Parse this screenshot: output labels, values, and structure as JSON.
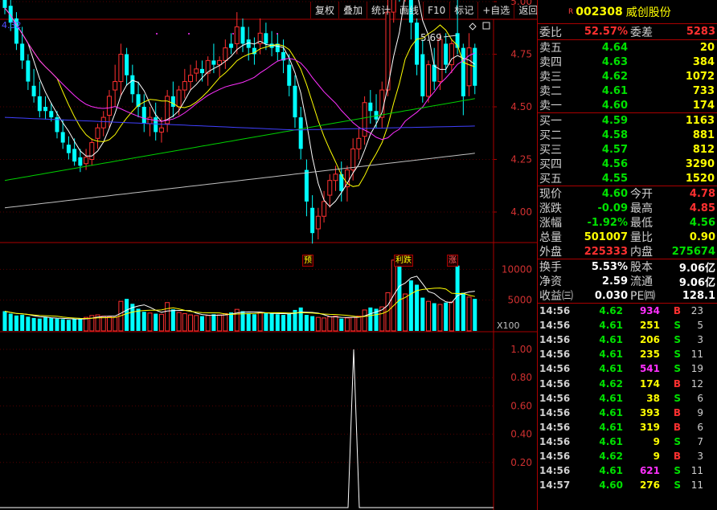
{
  "toolbar": [
    "复权",
    "叠加",
    "统计",
    "画线",
    "F10",
    "标记",
    "+自选",
    "返回"
  ],
  "price_corner": "4.32",
  "high_label": "5.69",
  "volume_unit": "X100",
  "tags": [
    "预",
    "利跌",
    "涨"
  ],
  "stock": {
    "badge": "R",
    "code": "002308",
    "name": "威创股份"
  },
  "order_ratio": {
    "label1": "委比",
    "value1": "52.57%",
    "label2": "委差",
    "value2": "5283"
  },
  "sell": [
    {
      "label": "卖五",
      "price": "4.64",
      "vol": "20"
    },
    {
      "label": "卖四",
      "price": "4.63",
      "vol": "384"
    },
    {
      "label": "卖三",
      "price": "4.62",
      "vol": "1072"
    },
    {
      "label": "卖二",
      "price": "4.61",
      "vol": "733"
    },
    {
      "label": "卖一",
      "price": "4.60",
      "vol": "174"
    }
  ],
  "buy": [
    {
      "label": "买一",
      "price": "4.59",
      "vol": "1163"
    },
    {
      "label": "买二",
      "price": "4.58",
      "vol": "881"
    },
    {
      "label": "买三",
      "price": "4.57",
      "vol": "812"
    },
    {
      "label": "买四",
      "price": "4.56",
      "vol": "3290"
    },
    {
      "label": "买五",
      "price": "4.55",
      "vol": "1520"
    }
  ],
  "quote": [
    {
      "l1": "现价",
      "v1": "4.60",
      "c1": "green",
      "l2": "今开",
      "v2": "4.78",
      "c2": "red"
    },
    {
      "l1": "涨跌",
      "v1": "-0.09",
      "c1": "green",
      "l2": "最高",
      "v2": "4.85",
      "c2": "red"
    },
    {
      "l1": "涨幅",
      "v1": "-1.92%",
      "c1": "green",
      "l2": "最低",
      "v2": "4.56",
      "c2": "green"
    },
    {
      "l1": "总量",
      "v1": "501007",
      "c1": "yellow",
      "l2": "量比",
      "v2": "0.90",
      "c2": "yellow"
    },
    {
      "l1": "外盘",
      "v1": "225333",
      "c1": "red",
      "l2": "内盘",
      "v2": "275674",
      "c2": "green"
    }
  ],
  "fund": [
    {
      "l1": "换手",
      "v1": "5.53%",
      "l2": "股本",
      "v2": "9.06亿"
    },
    {
      "l1": "净资",
      "v1": "2.59",
      "l2": "流通",
      "v2": "9.06亿"
    },
    {
      "l1": "收益㈢",
      "v1": "0.030",
      "l2": "PE㈣",
      "v2": "128.1"
    }
  ],
  "ticks": [
    {
      "t": "14:56",
      "p": "4.62",
      "pc": "green",
      "v": "934",
      "vc": "magenta",
      "bs": "B",
      "n": "23"
    },
    {
      "t": "14:56",
      "p": "4.61",
      "pc": "green",
      "v": "251",
      "vc": "yellow",
      "bs": "S",
      "n": "5"
    },
    {
      "t": "14:56",
      "p": "4.61",
      "pc": "green",
      "v": "206",
      "vc": "yellow",
      "bs": "S",
      "n": "3"
    },
    {
      "t": "14:56",
      "p": "4.61",
      "pc": "green",
      "v": "235",
      "vc": "yellow",
      "bs": "S",
      "n": "11"
    },
    {
      "t": "14:56",
      "p": "4.61",
      "pc": "green",
      "v": "541",
      "vc": "magenta",
      "bs": "S",
      "n": "19"
    },
    {
      "t": "14:56",
      "p": "4.62",
      "pc": "green",
      "v": "174",
      "vc": "yellow",
      "bs": "B",
      "n": "12"
    },
    {
      "t": "14:56",
      "p": "4.61",
      "pc": "green",
      "v": "38",
      "vc": "yellow",
      "bs": "S",
      "n": "6"
    },
    {
      "t": "14:56",
      "p": "4.61",
      "pc": "green",
      "v": "393",
      "vc": "yellow",
      "bs": "B",
      "n": "9"
    },
    {
      "t": "14:56",
      "p": "4.61",
      "pc": "green",
      "v": "319",
      "vc": "yellow",
      "bs": "B",
      "n": "6"
    },
    {
      "t": "14:56",
      "p": "4.61",
      "pc": "green",
      "v": "9",
      "vc": "yellow",
      "bs": "S",
      "n": "7"
    },
    {
      "t": "14:56",
      "p": "4.62",
      "pc": "green",
      "v": "9",
      "vc": "yellow",
      "bs": "B",
      "n": "3"
    },
    {
      "t": "14:56",
      "p": "4.61",
      "pc": "green",
      "v": "621",
      "vc": "magenta",
      "bs": "S",
      "n": "11"
    },
    {
      "t": "14:57",
      "p": "4.60",
      "pc": "green",
      "v": "276",
      "vc": "yellow",
      "bs": "S",
      "n": "11"
    }
  ],
  "colors": {
    "up": "#ff3030",
    "down": "#00ffff",
    "frame": "#aa0000",
    "ma5": "#ffffff",
    "ma10": "#ffff00",
    "ma20": "#ff30ff",
    "ma60": "#00d000",
    "ma120": "#4040ff",
    "ma250": "#c0c0c0"
  },
  "chart_data": {
    "type": "candlestick",
    "price_axis": {
      "ticks": [
        4.0,
        4.25,
        4.5,
        4.75,
        5.0,
        5.25,
        5.5
      ]
    },
    "volume_axis": {
      "ticks": [
        5000,
        10000
      ],
      "unit": "X100"
    },
    "indicator_axis": {
      "ticks": [
        0.2,
        0.4,
        0.6,
        0.8,
        1.0
      ]
    },
    "candles": [
      [
        5.02,
        5.08,
        4.97,
        4.94
      ],
      [
        4.98,
        5.02,
        4.9,
        4.86
      ],
      [
        4.92,
        4.95,
        4.8,
        4.77
      ],
      [
        4.8,
        4.88,
        4.72,
        4.68
      ],
      [
        4.72,
        4.75,
        4.62,
        4.58
      ],
      [
        4.6,
        4.68,
        4.55,
        4.52
      ],
      [
        4.55,
        4.62,
        4.48,
        4.45
      ],
      [
        4.5,
        4.55,
        4.48,
        4.44
      ],
      [
        4.48,
        4.52,
        4.45,
        4.43
      ],
      [
        4.45,
        4.48,
        4.38,
        4.35
      ],
      [
        4.38,
        4.44,
        4.33,
        4.3
      ],
      [
        4.32,
        4.36,
        4.28,
        4.25
      ],
      [
        4.3,
        4.35,
        4.24,
        4.22
      ],
      [
        4.26,
        4.3,
        4.22,
        4.19
      ],
      [
        4.23,
        4.3,
        4.26,
        4.2
      ],
      [
        4.25,
        4.35,
        4.33,
        4.22
      ],
      [
        4.35,
        4.42,
        4.4,
        4.3
      ],
      [
        4.4,
        4.48,
        4.45,
        4.36
      ],
      [
        4.46,
        4.58,
        4.55,
        4.4
      ],
      [
        4.58,
        4.7,
        4.62,
        4.5
      ],
      [
        4.62,
        4.8,
        4.75,
        4.55
      ],
      [
        4.75,
        4.78,
        4.65,
        4.6
      ],
      [
        4.65,
        4.7,
        4.56,
        4.52
      ],
      [
        4.56,
        4.62,
        4.5,
        4.45
      ],
      [
        4.5,
        4.56,
        4.42,
        4.38
      ],
      [
        4.42,
        4.5,
        4.45,
        4.36
      ],
      [
        4.45,
        4.52,
        4.38,
        4.34
      ],
      [
        4.38,
        4.45,
        4.4,
        4.33
      ],
      [
        4.42,
        4.58,
        4.55,
        4.38
      ],
      [
        4.55,
        4.62,
        4.5,
        4.45
      ],
      [
        4.5,
        4.6,
        4.58,
        4.46
      ],
      [
        4.58,
        4.68,
        4.62,
        4.54
      ],
      [
        4.62,
        4.7,
        4.65,
        4.58
      ],
      [
        4.66,
        4.72,
        4.68,
        4.62
      ],
      [
        4.68,
        4.72,
        4.66,
        4.62
      ],
      [
        4.66,
        4.74,
        4.72,
        4.6
      ],
      [
        4.72,
        4.8,
        4.7,
        4.66
      ],
      [
        4.7,
        4.74,
        4.72,
        4.64
      ],
      [
        4.72,
        4.82,
        4.78,
        4.68
      ],
      [
        4.8,
        4.85,
        4.78,
        4.75
      ],
      [
        4.8,
        4.95,
        4.88,
        4.75
      ],
      [
        4.88,
        4.92,
        4.8,
        4.76
      ],
      [
        4.82,
        4.88,
        4.78,
        4.72
      ],
      [
        4.78,
        4.83,
        4.75,
        4.7
      ],
      [
        4.8,
        4.92,
        4.85,
        4.75
      ],
      [
        4.85,
        4.9,
        4.8,
        4.77
      ],
      [
        4.8,
        4.86,
        4.78,
        4.74
      ],
      [
        4.8,
        4.85,
        4.76,
        4.72
      ],
      [
        4.76,
        4.82,
        4.72,
        4.66
      ],
      [
        4.7,
        4.75,
        4.6,
        4.55
      ],
      [
        4.6,
        4.65,
        4.45,
        4.4
      ],
      [
        4.45,
        4.5,
        4.3,
        4.25
      ],
      [
        4.2,
        4.25,
        4.05,
        3.98
      ],
      [
        4.02,
        4.08,
        3.9,
        3.85
      ],
      [
        3.92,
        4.02,
        3.98,
        3.87
      ],
      [
        3.98,
        4.1,
        4.05,
        3.95
      ],
      [
        4.08,
        4.18,
        4.15,
        4.02
      ],
      [
        4.15,
        4.22,
        4.18,
        4.1
      ],
      [
        4.18,
        4.24,
        4.1,
        4.05
      ],
      [
        4.12,
        4.22,
        4.2,
        4.05
      ],
      [
        4.2,
        4.35,
        4.3,
        4.15
      ],
      [
        4.3,
        4.4,
        4.35,
        4.25
      ],
      [
        4.36,
        4.55,
        4.52,
        4.32
      ],
      [
        4.52,
        4.58,
        4.48,
        4.42
      ],
      [
        4.48,
        4.56,
        4.44,
        4.4
      ],
      [
        4.45,
        4.62,
        4.58,
        4.4
      ],
      [
        4.58,
        5.05,
        4.95,
        4.55
      ],
      [
        4.95,
        5.6,
        5.25,
        4.9
      ],
      [
        5.25,
        5.35,
        5.05,
        5.0
      ],
      [
        5.05,
        5.4,
        5.35,
        5.0
      ],
      [
        5.25,
        5.28,
        4.9,
        4.82
      ],
      [
        4.9,
        4.92,
        4.7,
        4.65
      ],
      [
        4.75,
        4.82,
        4.55,
        4.52
      ],
      [
        4.55,
        4.72,
        4.7,
        4.52
      ],
      [
        4.7,
        4.78,
        4.62,
        4.58
      ],
      [
        4.62,
        4.85,
        4.82,
        4.58
      ],
      [
        4.8,
        4.85,
        4.7,
        4.66
      ],
      [
        4.7,
        4.82,
        4.8,
        4.66
      ],
      [
        4.85,
        5.69,
        4.78,
        4.75
      ],
      [
        4.78,
        4.8,
        4.55,
        4.46
      ],
      [
        4.6,
        4.85,
        4.78,
        4.55
      ],
      [
        4.78,
        4.8,
        4.6,
        4.56
      ]
    ],
    "volumes": [
      3200,
      2800,
      2500,
      2600,
      2300,
      2100,
      2000,
      2200,
      2100,
      2000,
      1900,
      1800,
      1900,
      2000,
      2200,
      2500,
      2600,
      2400,
      2300,
      2200,
      4800,
      5200,
      4400,
      3600,
      3100,
      2900,
      2800,
      2700,
      4600,
      3500,
      3000,
      2800,
      2600,
      2500,
      2400,
      2500,
      2700,
      2600,
      2800,
      3000,
      3500,
      3200,
      2900,
      2700,
      3000,
      2900,
      2800,
      2700,
      2600,
      2800,
      3400,
      3800,
      2600,
      2400,
      2200,
      2100,
      2300,
      2400,
      2000,
      2100,
      2200,
      2400,
      3400,
      3800,
      3600,
      3900,
      6200,
      11500,
      11200,
      6000,
      8200,
      7500,
      5400,
      4800,
      4500,
      4300,
      4600,
      4700,
      10600,
      6200,
      5500,
      5200
    ]
  }
}
